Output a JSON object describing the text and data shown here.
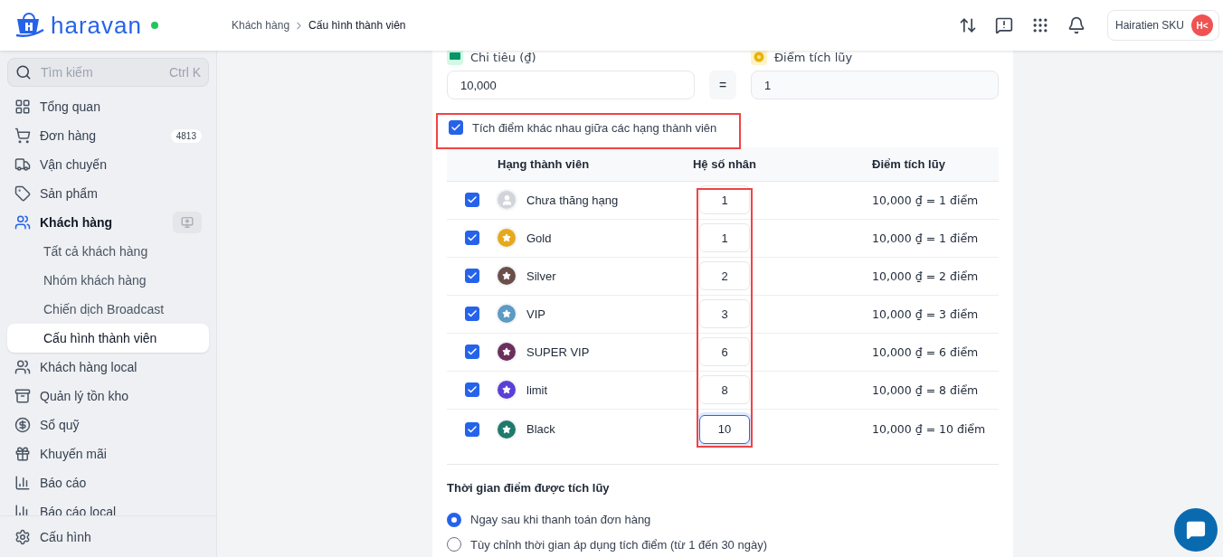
{
  "header": {
    "logo": "haravan",
    "breadcrumb": [
      "Khách hàng",
      "Cấu hình thành viên"
    ],
    "user": {
      "name": "Hairatien SKU",
      "initials": "H<"
    }
  },
  "sidebar": {
    "search": {
      "placeholder": "Tìm kiếm",
      "shortcut": "Ctrl K"
    },
    "items": [
      {
        "kind": "dashboard",
        "label": "Tổng quan",
        "selected": false
      },
      {
        "kind": "cart",
        "label": "Đơn hàng",
        "badge": "4813",
        "selected": false
      },
      {
        "kind": "truck",
        "label": "Vận chuyển",
        "selected": false
      },
      {
        "kind": "tag",
        "label": "Sản phẩm",
        "selected": false
      },
      {
        "kind": "users",
        "label": "Khách hàng",
        "selected": true,
        "children": [
          {
            "label": "Tất cả khách hàng",
            "selected": false
          },
          {
            "label": "Nhóm khách hàng",
            "selected": false
          },
          {
            "label": "Chiến dịch Broadcast",
            "selected": false
          },
          {
            "label": "Cấu hình thành viên",
            "selected": true
          }
        ]
      },
      {
        "kind": "users",
        "label": "Khách hàng local",
        "selected": false
      },
      {
        "kind": "archive",
        "label": "Quản lý tồn kho",
        "selected": false
      },
      {
        "kind": "dollar",
        "label": "Sổ quỹ",
        "selected": false
      },
      {
        "kind": "gift",
        "label": "Khuyến mãi",
        "selected": false
      },
      {
        "kind": "chart",
        "label": "Báo cáo",
        "selected": false
      },
      {
        "kind": "chart",
        "label": "Báo cáo local",
        "selected": false
      }
    ],
    "footer": {
      "label": "Cấu hình"
    }
  },
  "rate": {
    "spend_label": "Chi tiêu (₫)",
    "spend_value": "10,000",
    "equals": "=",
    "points_label": "Điểm tích lũy",
    "points_value": "1"
  },
  "different_points": {
    "label": "Tích điểm khác nhau giữa các hạng thành viên",
    "checked": true
  },
  "table": {
    "columns": [
      "Hạng thành viên",
      "Hệ số nhân",
      "Điểm tích lũy"
    ],
    "rows": [
      {
        "checked": true,
        "kind": "none",
        "name": "Chưa thăng hạng",
        "multiplier": "1",
        "points": "10,000 ₫ = 1 điểm",
        "focused": false
      },
      {
        "checked": true,
        "kind": "star",
        "color": "#e5a91a",
        "name": "Gold",
        "multiplier": "1",
        "points": "10,000 ₫ = 1 điểm",
        "focused": false
      },
      {
        "checked": true,
        "kind": "star",
        "color": "#6b4f4a",
        "name": "Silver",
        "multiplier": "2",
        "points": "10,000 ₫ = 2 điểm",
        "focused": false
      },
      {
        "checked": true,
        "kind": "star",
        "color": "#5b9bc4",
        "name": "VIP",
        "multiplier": "3",
        "points": "10,000 ₫ = 3 điểm",
        "focused": false
      },
      {
        "checked": true,
        "kind": "star",
        "color": "#6b2f5c",
        "name": "SUPER VIP",
        "multiplier": "6",
        "points": "10,000 ₫ = 6 điểm",
        "focused": false
      },
      {
        "checked": true,
        "kind": "star",
        "color": "#5b3fd6",
        "name": "limit",
        "multiplier": "8",
        "points": "10,000 ₫ = 8 điểm",
        "focused": false
      },
      {
        "checked": true,
        "kind": "star",
        "color": "#1f7a6b",
        "name": "Black",
        "multiplier": "10",
        "points": "10,000 ₫ = 10 điểm",
        "focused": true
      }
    ]
  },
  "timing": {
    "title": "Thời gian điểm được tích lũy",
    "options": [
      {
        "label": "Ngay sau khi thanh toán đơn hàng",
        "selected": true
      },
      {
        "label": "Tùy chỉnh thời gian áp dụng tích điểm (từ 1 đến 30 ngày)",
        "selected": false
      }
    ]
  }
}
